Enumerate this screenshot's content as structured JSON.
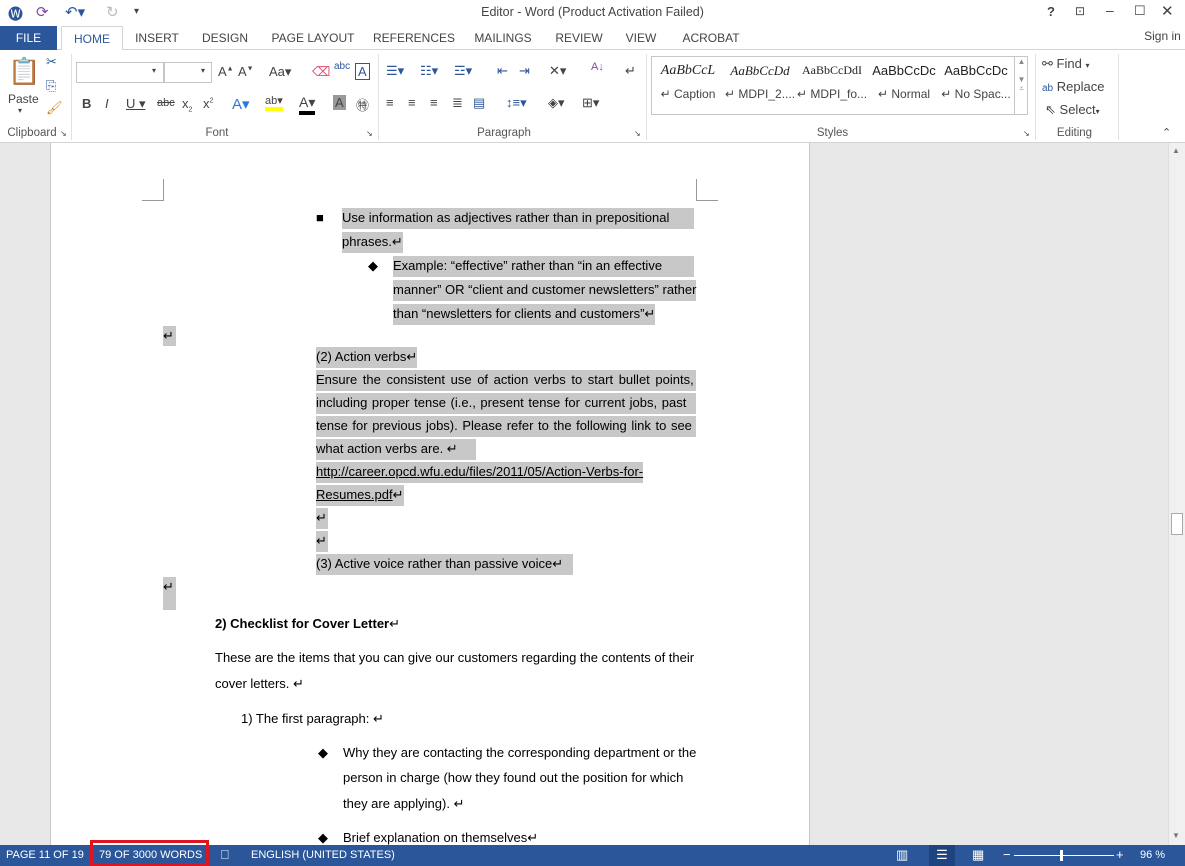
{
  "window": {
    "title": "Editor - Word (Product Activation Failed)",
    "help": "?",
    "sign_in": "Sign in"
  },
  "tabs": [
    "FILE",
    "HOME",
    "INSERT",
    "DESIGN",
    "PAGE LAYOUT",
    "REFERENCES",
    "MAILINGS",
    "REVIEW",
    "VIEW",
    "ACROBAT"
  ],
  "ribbon": {
    "clipboard": {
      "label": "Clipboard",
      "paste": "Paste"
    },
    "font": {
      "label": "Font",
      "font_name": "",
      "font_size": ""
    },
    "paragraph": {
      "label": "Paragraph"
    },
    "styles": {
      "label": "Styles",
      "items": [
        {
          "preview": "AaBbCcL",
          "name": "↵ Caption"
        },
        {
          "preview": "AaBbCcDd",
          "name": "↵ MDPI_2...."
        },
        {
          "preview": "AaBbCcDdI",
          "name": "↵ MDPI_fo..."
        },
        {
          "preview": "AaBbCcDc",
          "name": "↵ Normal"
        },
        {
          "preview": "AaBbCcDc",
          "name": "↵ No Spac..."
        }
      ]
    },
    "editing": {
      "label": "Editing",
      "find": "Find",
      "replace": "Replace",
      "select": "Select"
    }
  },
  "doc": {
    "lines": [
      "Use information as adjectives rather than in prepositional",
      "phrases.↵",
      "Example: “effective” rather than “in an effective",
      "manner” OR “client and customer newsletters” rather",
      "than “newsletters for clients and customers”↵",
      "↵",
      "(2) Action verbs↵",
      "Ensure the consistent use of action verbs to start bullet points,",
      "including proper tense (i.e., present tense for current jobs, past",
      "tense for previous jobs). Please refer to the following link to see",
      "what action verbs are.  ↵",
      "http://career.opcd.wfu.edu/files/2011/05/Action-Verbs-for-",
      "Resumes.pdf",
      "↵",
      "↵",
      "(3) Active voice rather than passive voice↵",
      "↵",
      "2) Checklist for Cover Letter",
      "These are the items that you can give our customers regarding the contents of their",
      "cover letters.  ↵",
      "1) The first paragraph:  ↵",
      "Why they are contacting the corresponding department or the",
      "person in charge (how they found out the position for which",
      "they are applying).  ↵",
      "Brief explanation on themselves↵"
    ],
    "square_bullet": "■",
    "diamond_bullet": "◆",
    "pilcrow": "↵"
  },
  "status": {
    "page": "PAGE 11 OF 19",
    "words": "79 OF 3000 WORDS",
    "language": "ENGLISH (UNITED STATES)",
    "zoom": "96 %",
    "zoom_percent": 96,
    "highlight_color": "#e0141e"
  }
}
